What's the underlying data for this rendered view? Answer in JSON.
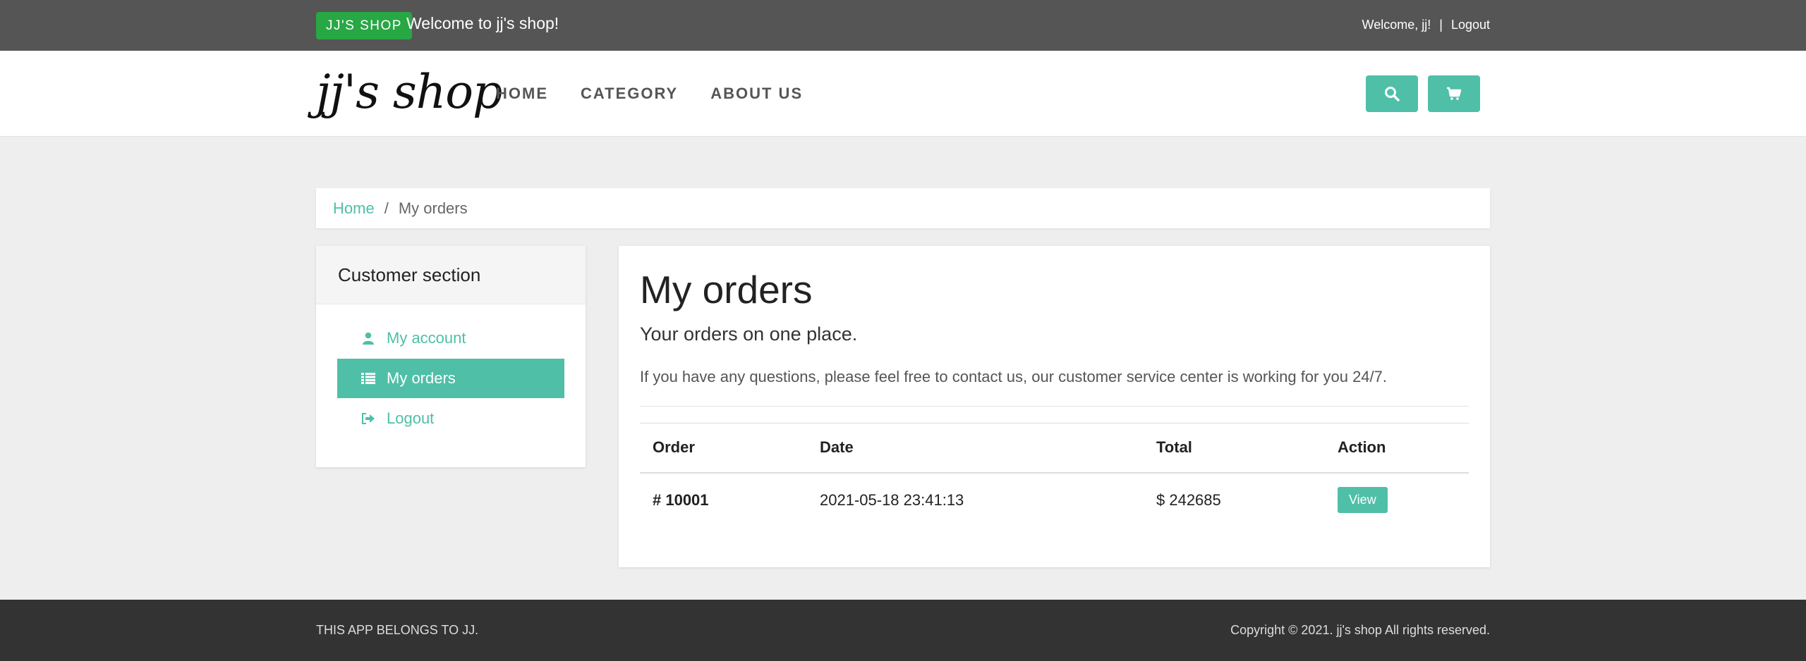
{
  "topbar": {
    "badge": "JJ'S SHOP",
    "welcome": "Welcome to jj's shop!",
    "user_greeting": "Welcome, jj!",
    "separator": "|",
    "logout": "Logout"
  },
  "navbar": {
    "logo": "jj's shop",
    "links": [
      "HOME",
      "CATEGORY",
      "ABOUT US"
    ],
    "search_icon": "search-icon",
    "cart_icon": "cart-icon"
  },
  "breadcrumb": {
    "home": "Home",
    "divider": "/",
    "current": "My orders"
  },
  "sidebar": {
    "title": "Customer section",
    "items": [
      {
        "label": "My account",
        "icon": "user-icon",
        "active": false
      },
      {
        "label": "My orders",
        "icon": "list-icon",
        "active": true
      },
      {
        "label": "Logout",
        "icon": "sign-out-icon",
        "active": false
      }
    ]
  },
  "main": {
    "title": "My orders",
    "lead": "Your orders on one place.",
    "info": "If you have any questions, please feel free to contact us, our customer service center is working for you 24/7.",
    "table": {
      "headers": [
        "Order",
        "Date",
        "Total",
        "Action"
      ],
      "rows": [
        {
          "order": "# 10001",
          "date": "2021-05-18 23:41:13",
          "total": "$ 242685",
          "action": "View"
        }
      ]
    }
  },
  "footer": {
    "left": "THIS APP BELONGS TO JJ.",
    "right": "Copyright © 2021. jj's shop All rights reserved."
  },
  "colors": {
    "accent": "#4fbfa8",
    "badge": "#28a745",
    "topbar": "#555555",
    "footer": "#333333"
  }
}
